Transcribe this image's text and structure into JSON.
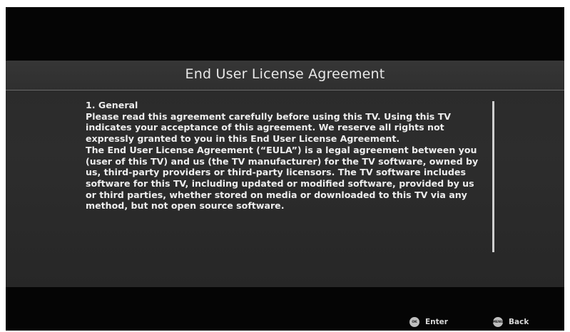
{
  "dialog": {
    "title": "End User License Agreement"
  },
  "eula": {
    "section_heading": "1. General",
    "paragraph_1": "Please read this agreement carefully before using this TV. Using this TV indicates your acceptance of this agreement. We reserve all rights not expressly granted to you in this End User License Agreement.",
    "paragraph_2": "The End User License Agreement (“EULA”) is a legal agreement between you (user of this TV) and us (the TV manufacturer) for the TV software, owned by us, third-party providers or third-party licensors. The TV software includes software for this TV, including updated or modified software, provided by us or third parties, whether stored on media or downloaded to this TV via any method, but not open source software."
  },
  "footer": {
    "ok_key_label": "OK",
    "enter_label": "Enter",
    "menu_key_label": "MENU",
    "back_label": "Back"
  },
  "colors": {
    "screen_background": "#050505",
    "dialog_background": "#2b2b2b",
    "text": "#ededed",
    "scrollbar": "#cfcfcf"
  },
  "icons": {
    "ok_button": "ok-button-icon",
    "menu_button": "menu-button-icon"
  }
}
